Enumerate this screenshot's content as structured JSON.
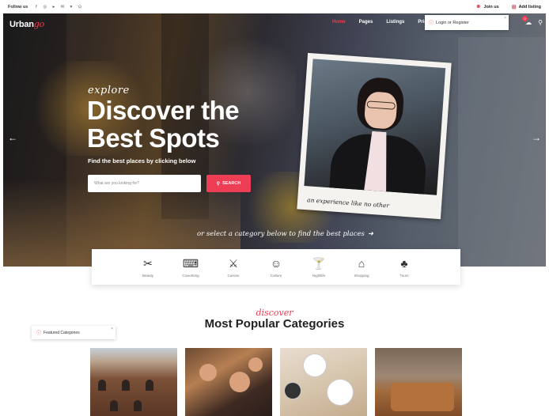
{
  "topbar": {
    "follow_label": "Follow us",
    "social_icons": [
      "facebook-icon",
      "instagram-icon",
      "youtube-icon",
      "twitter-icon",
      "pinterest-icon",
      "vk-icon"
    ],
    "social_glyphs": [
      "f",
      "◎",
      "▸",
      "✉",
      "▾",
      "⊙"
    ],
    "join_label": "Join us",
    "add_listing_label": "Add listing"
  },
  "nav": {
    "logo_text": "Urban",
    "logo_script": "go",
    "menu": [
      "Home",
      "Pages",
      "Listings",
      "Pricing"
    ],
    "active_index": 0,
    "cart_badge": "0"
  },
  "login_popup": {
    "label": "Login or Register",
    "close": "×"
  },
  "hero": {
    "explore": "explore",
    "headline_line1": "Discover the",
    "headline_line2": "Best Spots",
    "subtitle": "Find the best places by clicking below",
    "search_placeholder": "What are you looking for?",
    "search_button": "SEARCH",
    "polaroid_caption": "an experience like no other",
    "tagline": "or select a category below to find the best places",
    "arrow_left": "←",
    "arrow_right": "→"
  },
  "categories": [
    {
      "label": "Beauty",
      "icon": "scissors-icon",
      "glyph": "✂"
    },
    {
      "label": "Coworking",
      "icon": "desk-icon",
      "glyph": "⌨"
    },
    {
      "label": "Cuisine",
      "icon": "cutlery-icon",
      "glyph": "⚔"
    },
    {
      "label": "Culture",
      "icon": "theater-masks-icon",
      "glyph": "☺"
    },
    {
      "label": "Nightlife",
      "icon": "cocktail-icon",
      "glyph": "🍸"
    },
    {
      "label": "Shopping",
      "icon": "storefront-icon",
      "glyph": "⌂"
    },
    {
      "label": "Tours",
      "icon": "trees-icon",
      "glyph": "♣"
    }
  ],
  "popular": {
    "discover": "discover",
    "title": "Most Popular Categories"
  },
  "featured_popup": {
    "label": "Featured Categories",
    "close": "×"
  },
  "colors": {
    "accent": "#ee3e55"
  }
}
